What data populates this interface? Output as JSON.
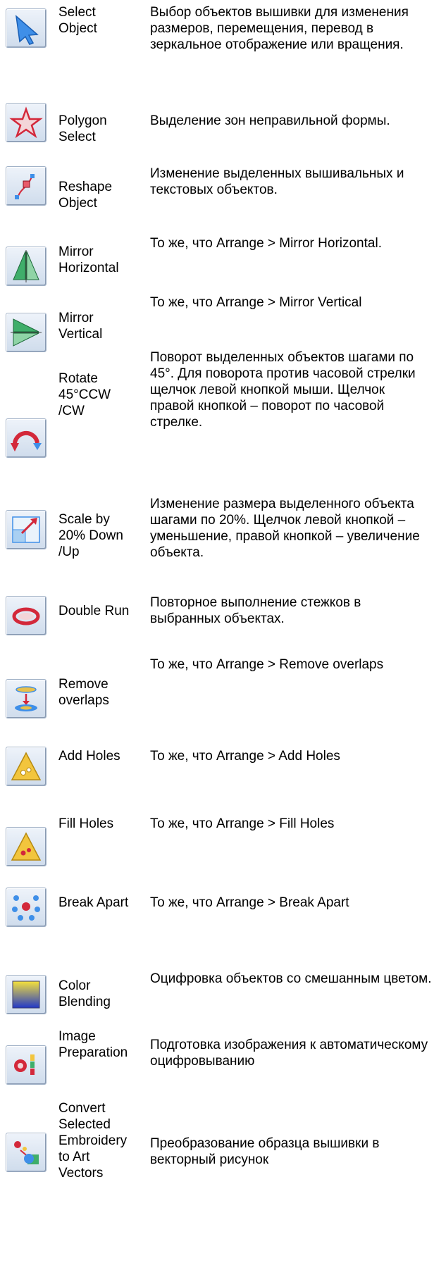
{
  "rows": [
    {
      "name": "Select\nObject",
      "desc": "Выбор объектов вышивки для изменения размеров, перемещения, перевод в зеркальное отображение или вращения.",
      "icon": "select-arrow-icon"
    },
    {
      "name": "Polygon\nSelect",
      "desc": "Выделение зон неправильной формы.",
      "icon": "polygon-select-star-icon"
    },
    {
      "name": "Reshape\nObject",
      "desc": "Изменение выделенных вышивальных и текстовых объектов.",
      "icon": "reshape-node-icon"
    },
    {
      "name": "Mirror\nHorizontal",
      "desc": "То же, что Arrange > Mirror Horizontal.",
      "icon": "mirror-horizontal-icon"
    },
    {
      "name": "Mirror\nVertical",
      "desc": "То же, что  Arrange > Mirror Vertical",
      "icon": "mirror-vertical-icon"
    },
    {
      "name": "Rotate\n45°CCW\n/CW",
      "desc": "Поворот выделенных объектов шагами по 45°. Для поворота против часовой стрелки щелчок левой кнопкой мыши. Щелчок правой кнопкой – поворот по часовой стрелке.",
      "icon": "rotate-arrow-icon"
    },
    {
      "name": "Scale by\n20% Down\n/Up",
      "desc": "Изменение размера выделенного объекта шагами по 20%. Щелчок левой кнопкой – уменьшение, правой кнопкой – увеличение объекта.",
      "icon": "scale-arrow-icon"
    },
    {
      "name": "Double Run",
      "desc": "Повторное выполнение стежков в выбранных объектах.",
      "icon": "double-run-loop-icon"
    },
    {
      "name": "Remove\noverlaps",
      "desc": "То же, что Arrange > Remove overlaps",
      "icon": "remove-overlaps-icon"
    },
    {
      "name": "Add Holes",
      "desc": "То же, что Arrange > Add Holes",
      "icon": "add-holes-triangle-icon"
    },
    {
      "name": "Fill Holes",
      "desc": "То же, что Arrange > Fill Holes",
      "icon": "fill-holes-triangle-icon"
    },
    {
      "name": "Break Apart",
      "desc": "То же, что Arrange > Break Apart",
      "icon": "break-apart-icon"
    },
    {
      "name": "Color\nBlending",
      "desc": "Оцифровка объектов со смешанным цветом.",
      "icon": "color-blending-gradient-icon"
    },
    {
      "name": "Image\nPreparation",
      "desc": "Подготовка изображения к автоматическому оцифровыванию",
      "icon": "image-preparation-icon"
    },
    {
      "name": "Convert\nSelected\nEmbroidery\nto Art\nVectors",
      "desc": "Преобразование образца вышивки в векторный рисунок",
      "icon": "convert-to-vectors-icon"
    }
  ]
}
